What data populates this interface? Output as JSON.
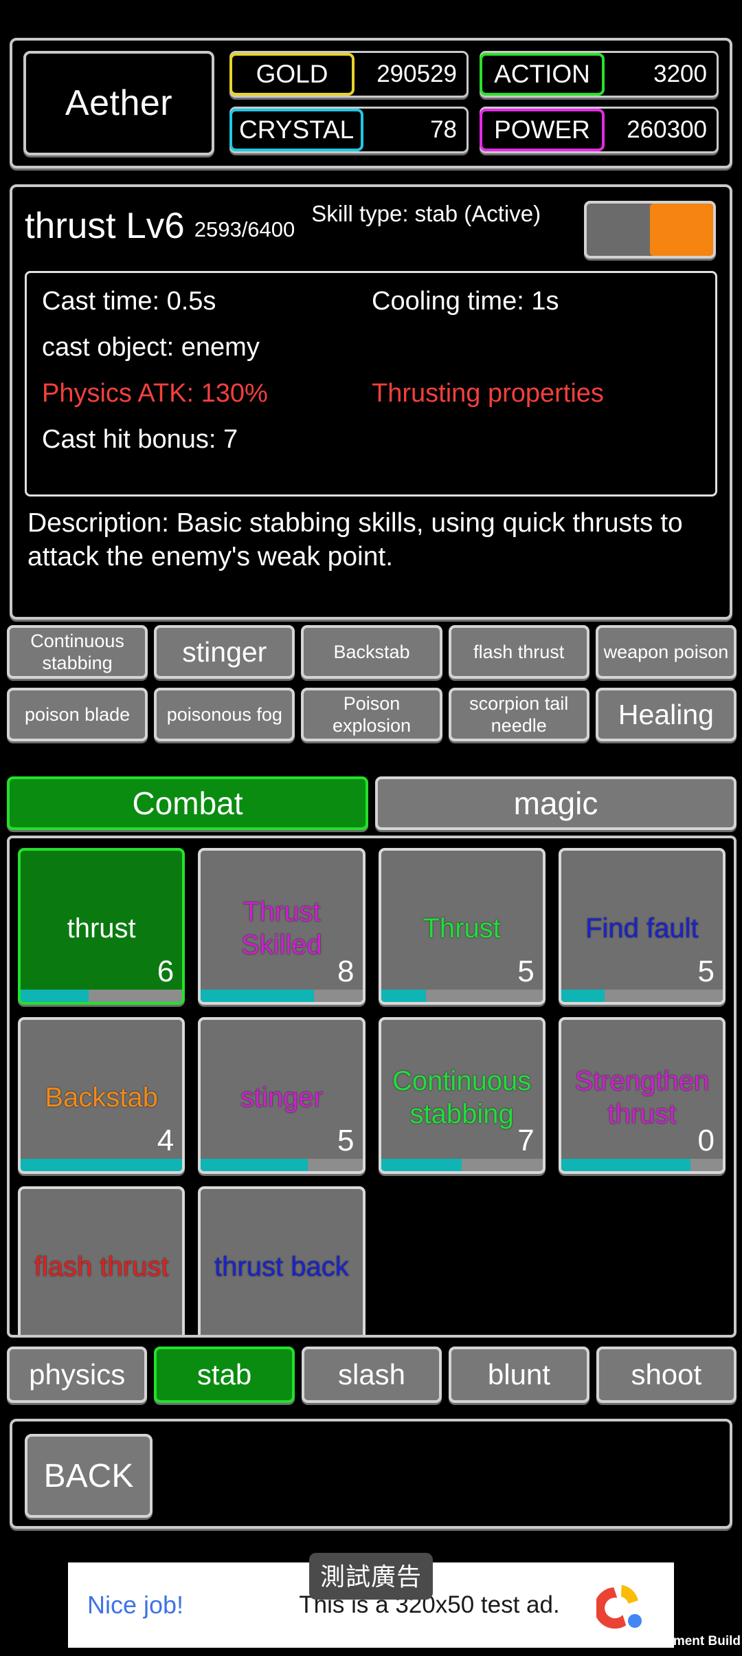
{
  "status_bar": {
    "player_name": "Aether",
    "stats": [
      {
        "label": "GOLD",
        "value": "290529",
        "color": "#e8d329"
      },
      {
        "label": "ACTION",
        "value": "3200",
        "color": "#2ae02a"
      },
      {
        "label": "CRYSTAL",
        "value": "78",
        "color": "#22c7e2"
      },
      {
        "label": "POWER",
        "value": "260300",
        "color": "#e52ae5"
      }
    ]
  },
  "skill_detail": {
    "name": "thrust Lv6",
    "xp": "2593/6400",
    "type_line": "Skill type: stab (Active)",
    "toggle_on": true,
    "cast_time_label": "Cast time: 0.5s",
    "cooling_time_label": "Cooling time: 1s",
    "cast_object_label": "cast object: enemy",
    "physics_atk_label": "Physics ATK: 130%",
    "properties_label": "Thrusting properties",
    "cast_hit_bonus_label": "Cast hit bonus: 7",
    "description": "Description: Basic stabbing skills, using quick thrusts to attack the enemy's weak point.",
    "highlight_color": "#f2403c"
  },
  "skill_chips": {
    "row1": [
      {
        "label": "Continuous stabbing",
        "big": false
      },
      {
        "label": "stinger",
        "big": true
      },
      {
        "label": "Backstab",
        "big": false
      },
      {
        "label": "flash thrust",
        "big": false
      },
      {
        "label": "weapon poison",
        "big": false
      }
    ],
    "row2": [
      {
        "label": "poison blade",
        "big": false
      },
      {
        "label": "poisonous fog",
        "big": false
      },
      {
        "label": "Poison explosion",
        "big": false
      },
      {
        "label": "scorpion tail needle",
        "big": false
      },
      {
        "label": "Healing",
        "big": true
      }
    ]
  },
  "category_tabs": [
    {
      "label": "Combat",
      "active": true
    },
    {
      "label": "magic",
      "active": false
    }
  ],
  "skill_cards": [
    {
      "name": "thrust",
      "level": "6",
      "color": "#ffffff",
      "selected": true,
      "progress": 42
    },
    {
      "name": "Thrust Skilled",
      "level": "8",
      "color": "#cc22cc",
      "selected": false,
      "progress": 70
    },
    {
      "name": "Thrust",
      "level": "5",
      "color": "#22dd3a",
      "selected": false,
      "progress": 28
    },
    {
      "name": "Find fault",
      "level": "5",
      "color": "#1a23c9",
      "selected": false,
      "progress": 27
    },
    {
      "name": "Backstab",
      "level": "4",
      "color": "#f08a1a",
      "selected": false,
      "progress": 100
    },
    {
      "name": "stinger",
      "level": "5",
      "color": "#cc22cc",
      "selected": false,
      "progress": 66
    },
    {
      "name": "Continuous stabbing",
      "level": "7",
      "color": "#22dd3a",
      "selected": false,
      "progress": 50
    },
    {
      "name": "Strengthen thrust",
      "level": "0",
      "color": "#cc22cc",
      "selected": false,
      "progress": 80
    },
    {
      "name": "flash thrust",
      "level": "",
      "color": "#e02020",
      "selected": false,
      "progress": 0
    },
    {
      "name": "thrust back",
      "level": "",
      "color": "#1a23c9",
      "selected": false,
      "progress": 0
    }
  ],
  "filter_tabs": [
    {
      "label": "physics",
      "active": false
    },
    {
      "label": "stab",
      "active": true
    },
    {
      "label": "slash",
      "active": false
    },
    {
      "label": "blunt",
      "active": false
    },
    {
      "label": "shoot",
      "active": false
    }
  ],
  "footer": {
    "back_label": "BACK"
  },
  "ad": {
    "badge": "測試廣告",
    "cta": "Nice job!",
    "text": "This is a 320x50 test ad.",
    "watermark": "Development Build"
  }
}
